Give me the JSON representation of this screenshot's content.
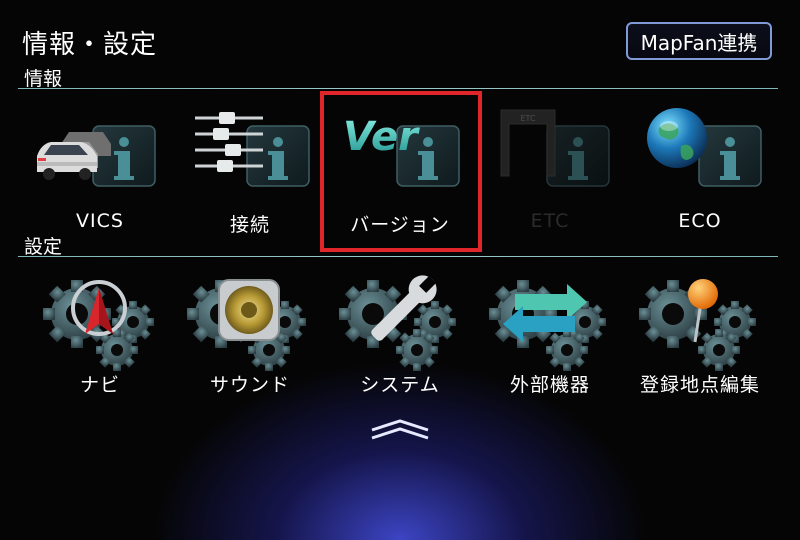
{
  "header": {
    "title": "情報・設定",
    "link_button": "MapFan連携"
  },
  "info_section": {
    "label": "情報",
    "items": [
      {
        "label": "VICS",
        "icon": "cars-info-icon"
      },
      {
        "label": "接続",
        "icon": "connectors-info-icon"
      },
      {
        "label": "バージョン",
        "icon": "version-info-icon",
        "icon_text": "Ver",
        "selected": true
      },
      {
        "label": "ETC",
        "icon": "etc-info-icon",
        "icon_text": "ETC",
        "disabled": true
      },
      {
        "label": "ECO",
        "icon": "globe-info-icon"
      }
    ]
  },
  "settings_section": {
    "label": "設定",
    "items": [
      {
        "label": "ナビ",
        "icon": "navi-gear-icon"
      },
      {
        "label": "サウンド",
        "icon": "speaker-gear-icon"
      },
      {
        "label": "システム",
        "icon": "wrench-gear-icon"
      },
      {
        "label": "外部機器",
        "icon": "arrows-gear-icon"
      },
      {
        "label": "登録地点編集",
        "icon": "pin-gear-icon"
      }
    ]
  },
  "footer": {
    "icon": "chevron-up-icon"
  },
  "colors": {
    "background": "#050505",
    "selection": "#e0262b",
    "divider": "#8fc1c1",
    "button_border": "#7f9ad6",
    "glow": "#4650e6"
  }
}
